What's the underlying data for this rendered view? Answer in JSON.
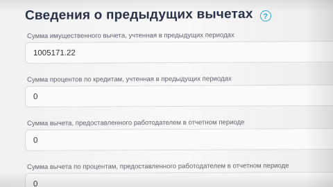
{
  "section": {
    "title": "Сведения о предыдущих вычетах"
  },
  "fields": [
    {
      "label": "Сумма имущественного вычета, учтенная в предыдущих периодах",
      "value": "1005171.22"
    },
    {
      "label": "Сумма процентов по кредитам, учтенная в предыдущих периодах",
      "value": "0"
    },
    {
      "label": "Сумма вычета, предоставленного работодателем в отчетном периоде",
      "value": "0"
    },
    {
      "label": "Сумма вычета по процентам, предоставленного работодателем в отчетном периоде",
      "value": "0"
    }
  ],
  "icons": {
    "help": "question-circle-icon",
    "help_glyph": "?"
  },
  "colors": {
    "accent": "#2ea8d8",
    "title": "#273148",
    "label": "#5d6270",
    "field_border": "#d8d8d8"
  }
}
